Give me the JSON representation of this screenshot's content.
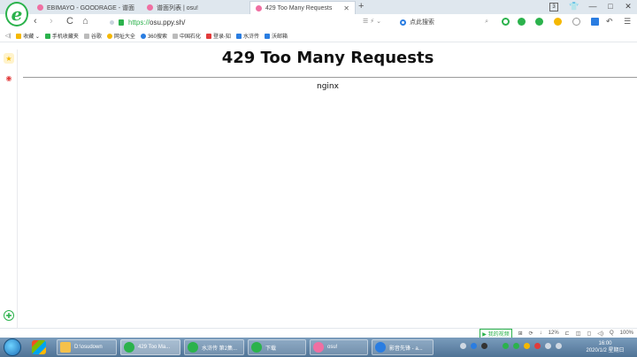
{
  "browser": {
    "tabs": [
      {
        "title": "EBIMAYO - GOODRAGE - 谱面",
        "active": false
      },
      {
        "title": "谱面列表 | osu!",
        "active": false
      },
      {
        "title": "429 Too Many Requests",
        "active": true
      }
    ],
    "new_tab_label": "+",
    "window_controls": {
      "badge": "3",
      "minimize": "—",
      "maximize": "□",
      "close": "✕"
    },
    "nav": {
      "back": "‹",
      "forward": "›",
      "reload": "C",
      "home": "⌂"
    },
    "url": {
      "scheme": "https://",
      "host": "osu.ppy.sh/"
    },
    "url_right": "☰ ⚡ ⌄",
    "search": {
      "placeholder": "点此搜索"
    },
    "bookmarks": [
      {
        "label": "收藏 ⌄",
        "color": "#f5b800"
      },
      {
        "label": "手机收藏夹",
        "color": "#2bb24c"
      },
      {
        "label": "谷歌",
        "color": "#bbbbbb"
      },
      {
        "label": "网址大全",
        "color": "#f5b800"
      },
      {
        "label": "360搜索",
        "color": "#2a7de1"
      },
      {
        "label": "中国石化",
        "color": "#bbbbbb"
      },
      {
        "label": "登录-知",
        "color": "#e23b3b"
      },
      {
        "label": "水浒传",
        "color": "#2a7de1"
      },
      {
        "label": "沃邮箱",
        "color": "#2a7de1"
      }
    ]
  },
  "page": {
    "heading": "429 Too Many Requests",
    "server": "nginx"
  },
  "statusbar": {
    "items": [
      "▶ 我的视频",
      "⊞",
      "⟳",
      "↓",
      "12%",
      "⊏",
      "◫",
      "◻",
      "◁)",
      "Q",
      "100%"
    ]
  },
  "taskbar": {
    "items": [
      {
        "label": "D:\\osudown",
        "color": "#f5c14b",
        "active": false
      },
      {
        "label": "429 Too Ma...",
        "color": "#2bb24c",
        "active": true
      },
      {
        "label": "水浒传 第2集...",
        "color": "#2bb24c",
        "active": false
      },
      {
        "label": "下载",
        "color": "#2bb24c",
        "active": false
      },
      {
        "label": "osu!",
        "color": "#f06fa2",
        "active": false
      },
      {
        "label": "影音先锋 - a...",
        "color": "#2a7de1",
        "active": false
      }
    ],
    "clock_time": "16:00",
    "clock_date": "2020/1/2 星期日"
  },
  "colors": {
    "accent": "#2bb24c",
    "tab_strip": "#dfe7ee",
    "osu_pink": "#f06fa2"
  }
}
